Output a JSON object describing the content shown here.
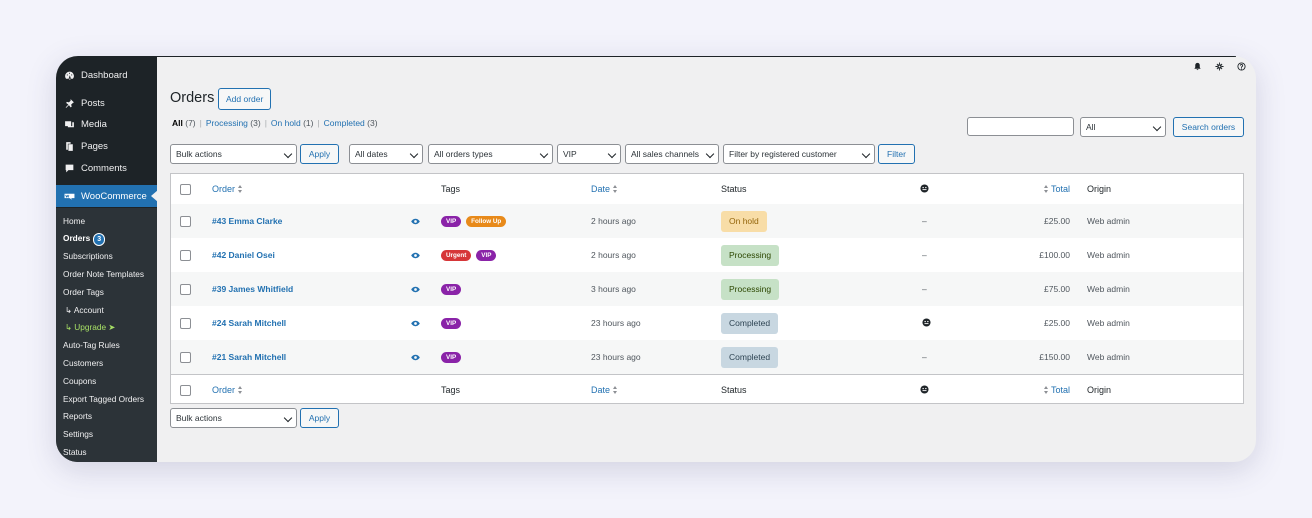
{
  "sidebar": {
    "main_items": [
      {
        "label": "Dashboard",
        "icon": "dashboard-icon"
      },
      {
        "label": "Posts",
        "icon": "pin-icon"
      },
      {
        "label": "Media",
        "icon": "media-icon"
      },
      {
        "label": "Pages",
        "icon": "pages-icon"
      },
      {
        "label": "Comments",
        "icon": "comments-icon"
      }
    ],
    "woocommerce": {
      "label": "WooCommerce",
      "icon": "woocommerce-icon"
    },
    "sub_items": {
      "home": "Home",
      "orders": "Orders",
      "orders_count": "3",
      "subscriptions": "Subscriptions",
      "order_note_templates": "Order Note Templates",
      "order_tags": "Order Tags",
      "account": "Account",
      "upgrade": "Upgrade",
      "auto_tag_rules": "Auto-Tag Rules",
      "customers": "Customers",
      "coupons": "Coupons",
      "export_tagged_orders": "Export Tagged Orders",
      "reports": "Reports",
      "settings": "Settings",
      "status": "Status"
    }
  },
  "header": {
    "title": "Orders",
    "add_order": "Add order"
  },
  "views": {
    "all": "All",
    "all_count": "(7)",
    "processing": "Processing",
    "processing_count": "(3)",
    "on_hold": "On hold",
    "on_hold_count": "(1)",
    "completed": "Completed",
    "completed_count": "(3)",
    "separator": "|"
  },
  "search": {
    "value": "",
    "scope": "All",
    "button": "Search orders"
  },
  "filters": {
    "bulk_actions": "Bulk actions",
    "apply": "Apply",
    "dates": "All dates",
    "order_types": "All orders types",
    "tag": "VIP",
    "sales_channels": "All sales channels",
    "customer": "Filter by registered customer",
    "filter_button": "Filter"
  },
  "table": {
    "columns": {
      "order": "Order",
      "tags": "Tags",
      "date": "Date",
      "status": "Status",
      "total": "Total",
      "origin": "Origin"
    },
    "rows": [
      {
        "order": "#43 Emma Clarke",
        "tags": [
          {
            "label": "VIP",
            "color": "#8a23a8"
          },
          {
            "label": "Follow Up",
            "color": "#e88a1a"
          }
        ],
        "date": "2 hours ago",
        "status": "On hold",
        "status_class": "st-hold",
        "note": "–",
        "total": "£25.00",
        "origin": "Web admin"
      },
      {
        "order": "#42 Daniel Osei",
        "tags": [
          {
            "label": "Urgent",
            "color": "#d63638"
          },
          {
            "label": "VIP",
            "color": "#8a23a8"
          }
        ],
        "date": "2 hours ago",
        "status": "Processing",
        "status_class": "st-proc",
        "note": "–",
        "total": "£100.00",
        "origin": "Web admin"
      },
      {
        "order": "#39 James Whitfield",
        "tags": [
          {
            "label": "VIP",
            "color": "#8a23a8"
          }
        ],
        "date": "3 hours ago",
        "status": "Processing",
        "status_class": "st-proc",
        "note": "–",
        "total": "£75.00",
        "origin": "Web admin"
      },
      {
        "order": "#24 Sarah Mitchell",
        "tags": [
          {
            "label": "VIP",
            "color": "#8a23a8"
          }
        ],
        "date": "23 hours ago",
        "status": "Completed",
        "status_class": "st-comp",
        "note": "smiley",
        "total": "£25.00",
        "origin": "Web admin"
      },
      {
        "order": "#21 Sarah Mitchell",
        "tags": [
          {
            "label": "VIP",
            "color": "#8a23a8"
          }
        ],
        "date": "23 hours ago",
        "status": "Completed",
        "status_class": "st-comp",
        "note": "–",
        "total": "£150.00",
        "origin": "Web admin"
      }
    ]
  },
  "bottom": {
    "bulk_actions": "Bulk actions",
    "apply": "Apply"
  },
  "colors": {
    "accent": "#2271b1",
    "sidebar_bg": "#1d2327",
    "woo_active": "#2271b1"
  }
}
